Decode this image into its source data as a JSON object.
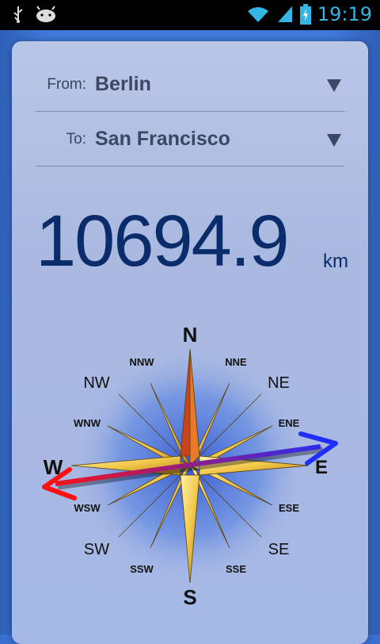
{
  "status": {
    "time": "19:19",
    "icons": [
      "usb-icon",
      "android-debug-icon",
      "wifi-icon",
      "signal-icon",
      "battery-charging-icon"
    ]
  },
  "form": {
    "from_label": "From:",
    "from_value": "Berlin",
    "to_label": "To:",
    "to_value": "San Francisco"
  },
  "result": {
    "distance": "10694.9",
    "unit": "km"
  },
  "compass": {
    "labels": {
      "N": "N",
      "NNE": "NNE",
      "NE": "NE",
      "ENE": "ENE",
      "E": "E",
      "ESE": "ESE",
      "SE": "SE",
      "SSE": "SSE",
      "S": "S",
      "SSW": "SSW",
      "SW": "SW",
      "WSW": "WSW",
      "W": "W",
      "WNW": "WNW",
      "NW": "NW",
      "NNW": "NNW"
    },
    "colors": {
      "star_gold": "#f2c84b",
      "north_red": "#c8441c",
      "arrow_red": "#ff1010",
      "arrow_blue": "#1f2dff"
    }
  }
}
